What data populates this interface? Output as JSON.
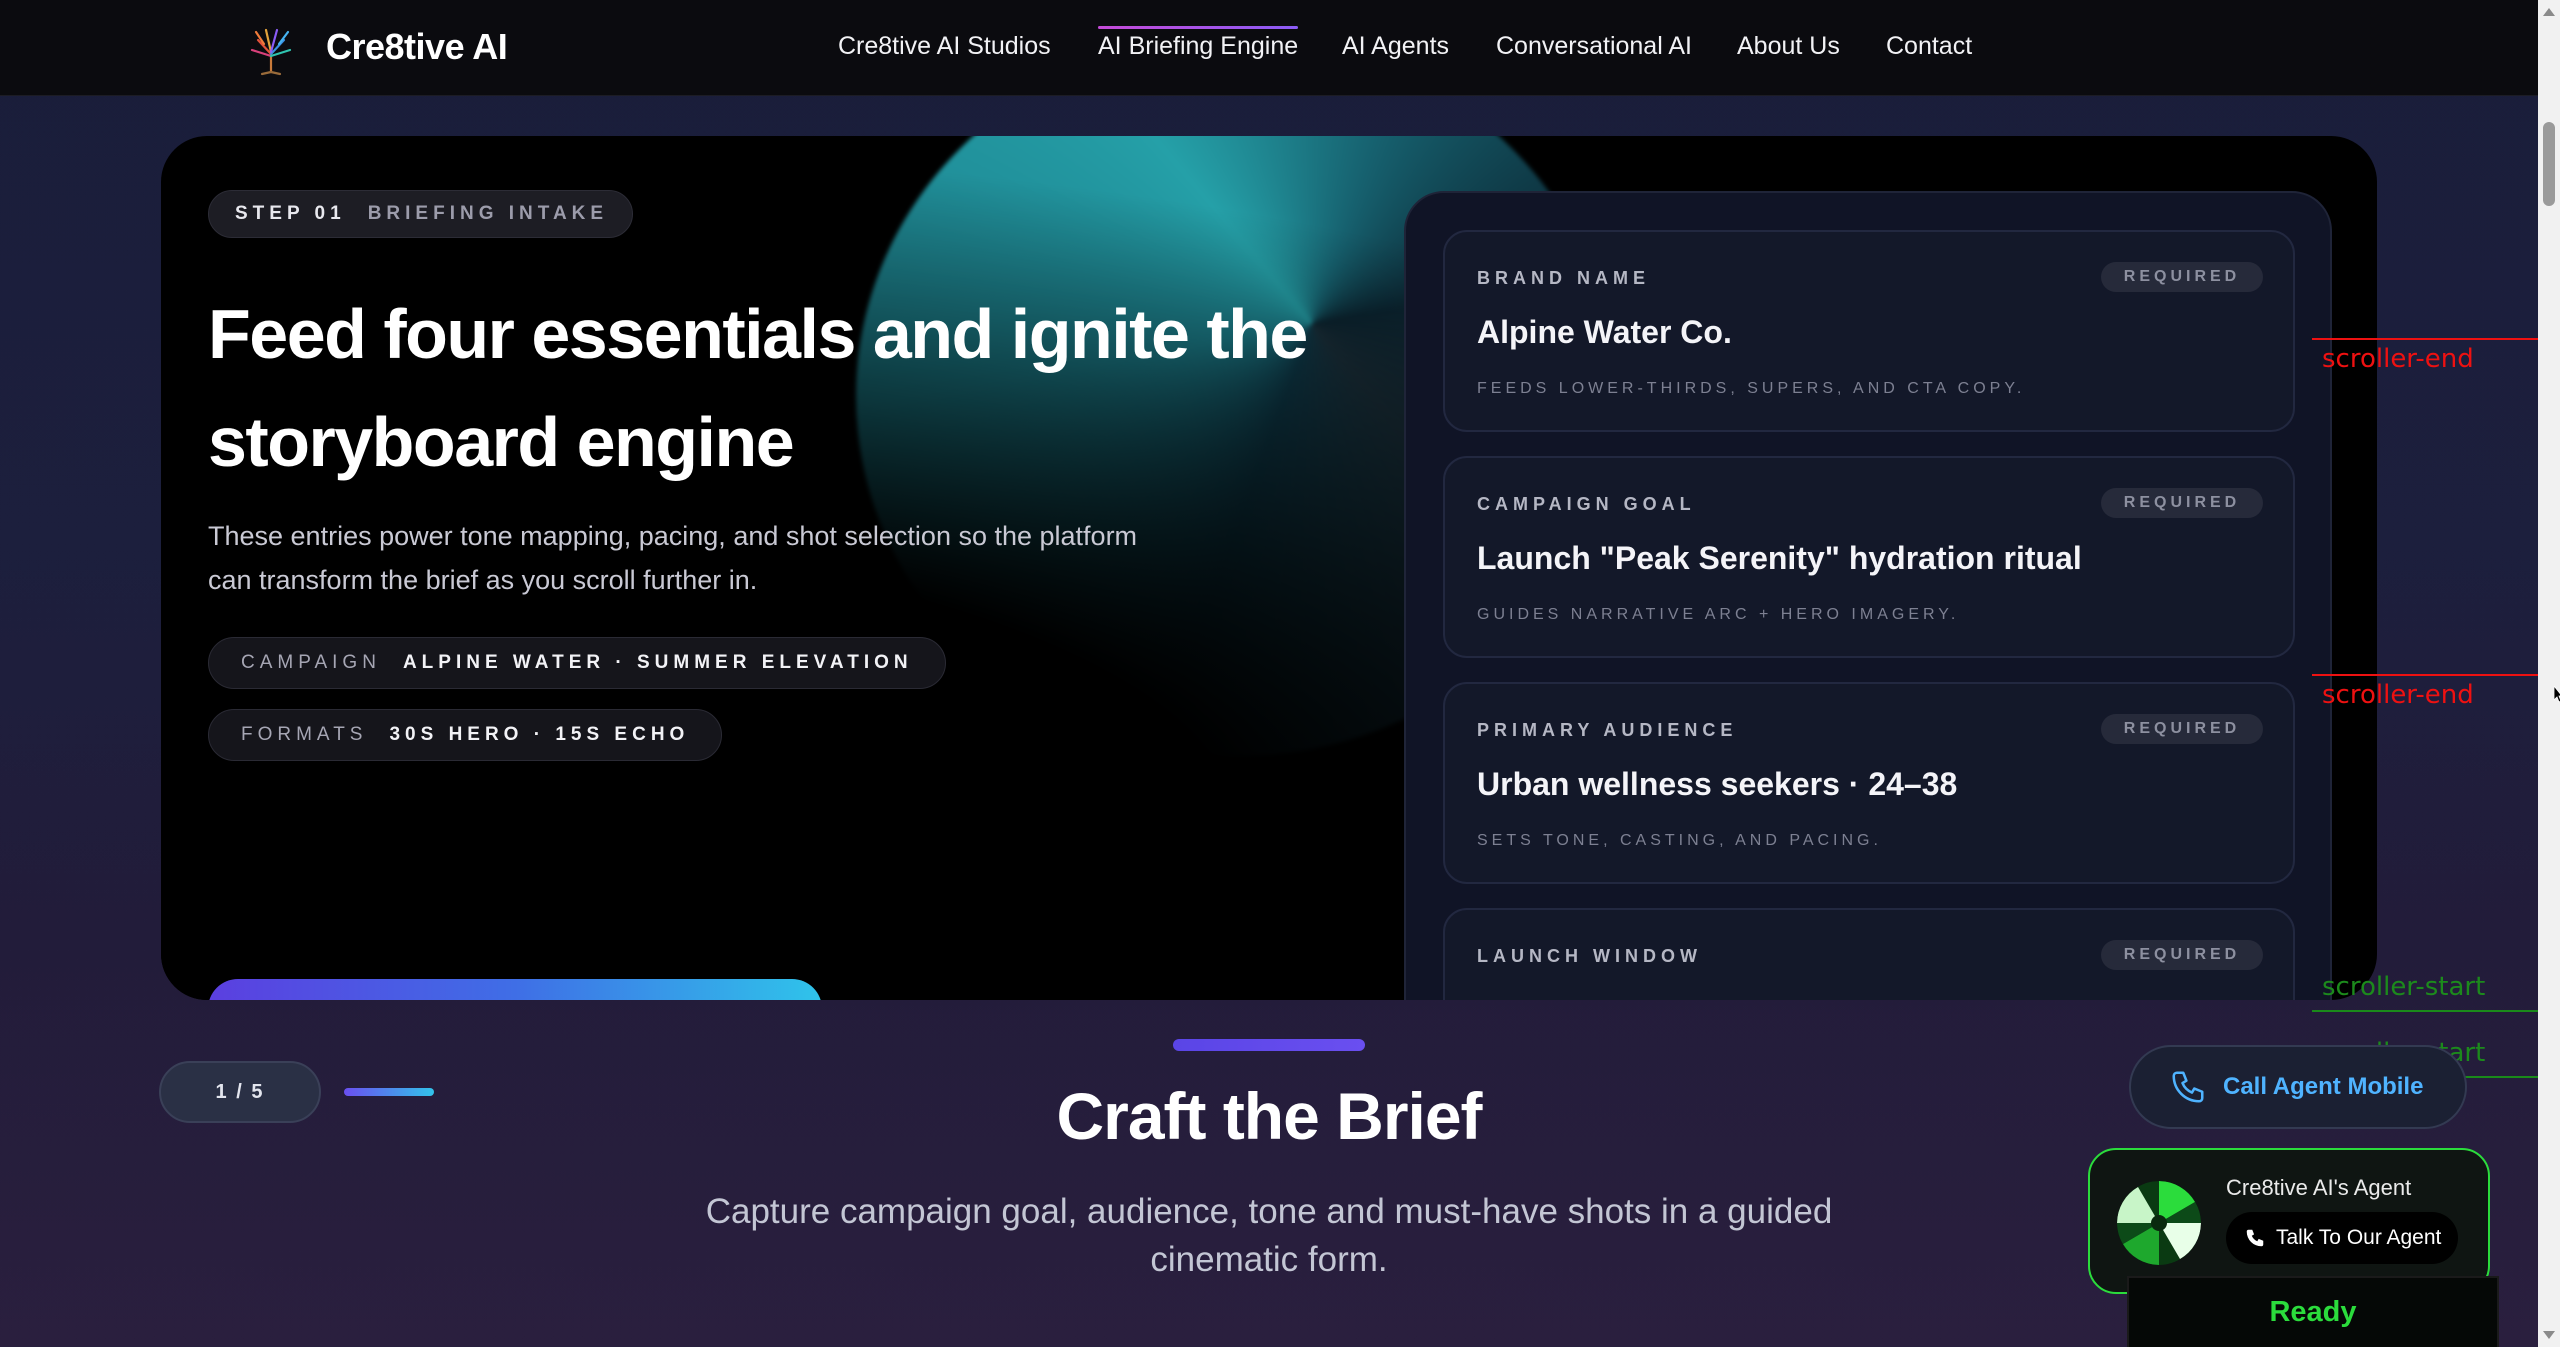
{
  "brand": {
    "name": "Cre8tive AI"
  },
  "nav": {
    "items": [
      {
        "label": "Cre8tive AI Studios"
      },
      {
        "label": "AI Briefing Engine",
        "active": true
      },
      {
        "label": "AI Agents"
      },
      {
        "label": "Conversational AI"
      },
      {
        "label": "About Us"
      },
      {
        "label": "Contact"
      }
    ]
  },
  "hero": {
    "step_key": "STEP 01",
    "step_value": "BRIEFING INTAKE",
    "title": "Feed four essentials and ignite the storyboard engine",
    "description": "These entries power tone mapping, pacing, and shot selection so the platform can transform the brief as you scroll further in.",
    "chips": [
      {
        "key": "CAMPAIGN",
        "value": "ALPINE WATER · SUMMER ELEVATION"
      },
      {
        "key": "FORMATS",
        "value": "30S HERO · 15S ECHO"
      }
    ]
  },
  "form": {
    "fields": [
      {
        "label": "BRAND NAME",
        "badge": "REQUIRED",
        "value": "Alpine Water Co.",
        "hint": "FEEDS LOWER-THIRDS, SUPERS, AND CTA COPY."
      },
      {
        "label": "CAMPAIGN GOAL",
        "badge": "REQUIRED",
        "value": "Launch \"Peak Serenity\" hydration ritual",
        "hint": "GUIDES NARRATIVE ARC + HERO IMAGERY."
      },
      {
        "label": "PRIMARY AUDIENCE",
        "badge": "REQUIRED",
        "value": "Urban wellness seekers · 24–38",
        "hint": "SETS TONE, CASTING, AND PACING."
      },
      {
        "label": "LAUNCH WINDOW",
        "badge": "REQUIRED",
        "value": "",
        "hint": ""
      }
    ]
  },
  "markers": {
    "end_1": "scroller-end",
    "end_2": "scroller-end",
    "start_1": "scroller-start",
    "start_2": "scroller-start"
  },
  "pager": {
    "label": "1 / 5",
    "progress": 0.2
  },
  "section": {
    "title": "Craft the Brief",
    "description": "Capture campaign goal, audience, tone and must-have shots in a guided cinematic form."
  },
  "call_agent": {
    "label": "Call Agent Mobile"
  },
  "agent_widget": {
    "name": "Cre8tive AI's Agent",
    "talk_label": "Talk To Our Agent",
    "status": "Ready"
  },
  "colors": {
    "accent_green": "#2bdc3c",
    "accent_blue": "#4fb3ff",
    "marker_red": "#e11111",
    "marker_green": "#1c8a1c"
  }
}
